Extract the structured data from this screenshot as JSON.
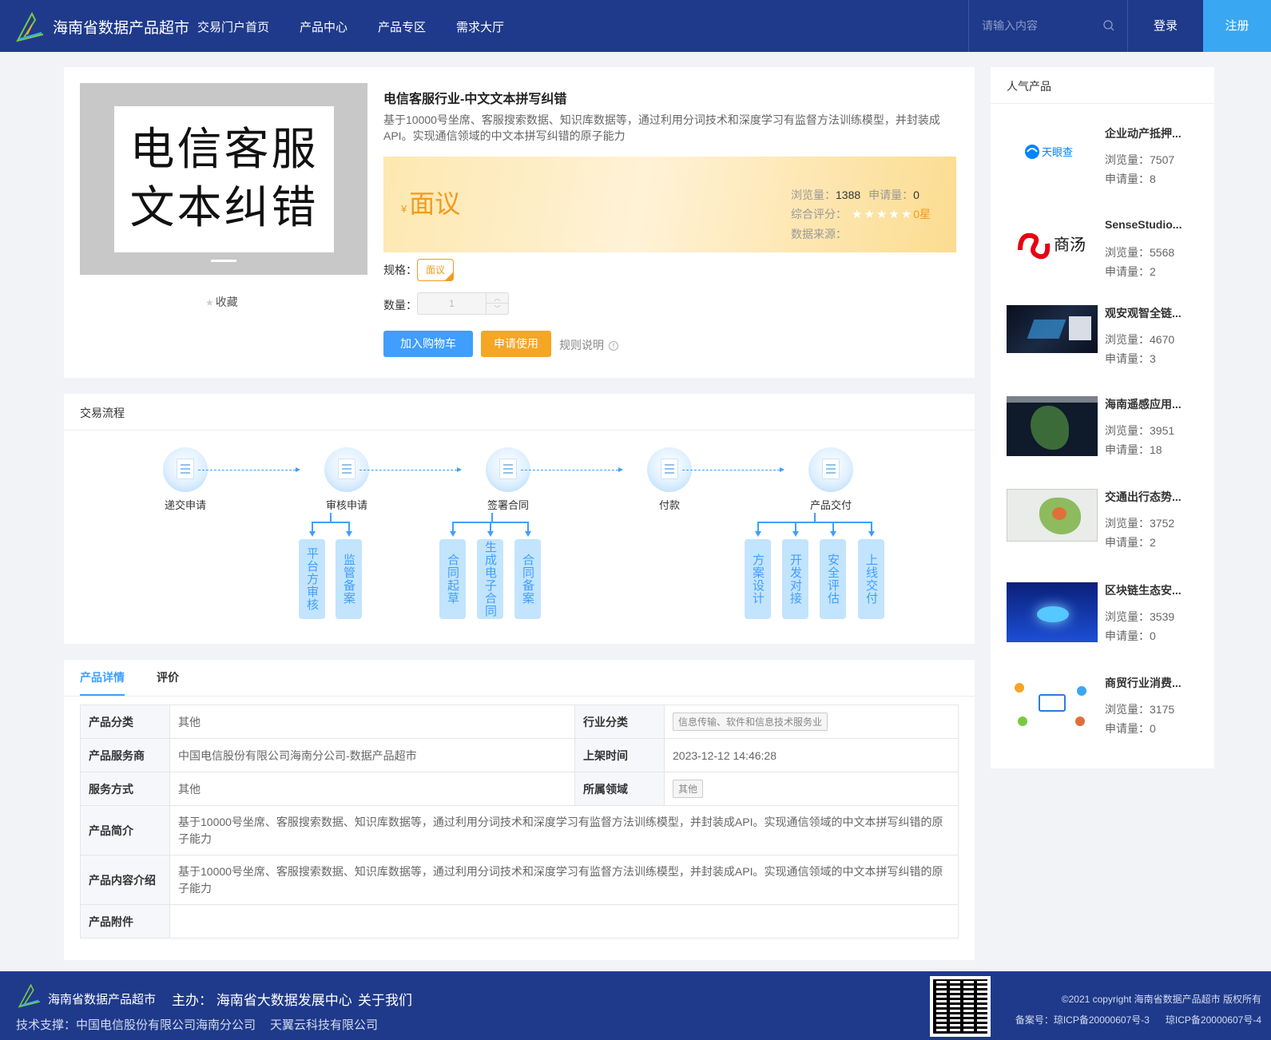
{
  "header": {
    "brand": "海南省数据产品超市",
    "nav": [
      "交易门户首页",
      "产品中心",
      "产品专区",
      "需求大厅"
    ],
    "search_placeholder": "请输入内容",
    "login": "登录",
    "register": "注册"
  },
  "product": {
    "image_text_line1": "电信客服",
    "image_text_line2": "文本纠错",
    "favorite": "收藏",
    "title": "电信客服行业-中文文本拼写纠错",
    "description": "基于10000号坐席、客服搜索数据、知识库数据等，通过利用分词技术和深度学习有监督方法训练模型，并封装成API。实现通信领域的中文本拼写纠错的原子能力",
    "currency": "¥",
    "price": "面议",
    "views_label": "浏览量：",
    "views": "1388",
    "applies_label": "申请量：",
    "applies": "0",
    "rating_label": "综合评分：",
    "rating_text": "0星",
    "rating_stars": 0,
    "source_label": "数据来源：",
    "spec_label": "规格：",
    "spec_value": "面议",
    "qty_label": "数量：",
    "qty_value": "1",
    "btn_cart": "加入购物车",
    "btn_apply": "申请使用",
    "rules": "规则说明"
  },
  "flow": {
    "title": "交易流程",
    "steps": [
      "递交申请",
      "审核申请",
      "签署合同",
      "付款",
      "产品交付"
    ],
    "audit_children": [
      "平台方审核",
      "监管备案"
    ],
    "contract_children": [
      "合同起草",
      "生成电子合同",
      "合同备案"
    ],
    "delivery_children": [
      "方案设计",
      "开发对接",
      "安全评估",
      "上线交付"
    ]
  },
  "detail": {
    "tabs": [
      "产品详情",
      "评价"
    ],
    "rows": {
      "category_k": "产品分类",
      "category_v": "其他",
      "industry_k": "行业分类",
      "industry_v": "信息传输、软件和信息技术服务业",
      "provider_k": "产品服务商",
      "provider_v": "中国电信股份有限公司海南分公司-数据产品超市",
      "online_k": "上架时间",
      "online_v": "2023-12-12 14:46:28",
      "service_k": "服务方式",
      "service_v": "其他",
      "domain_k": "所属领域",
      "domain_v": "其他",
      "intro_k": "产品简介",
      "intro_v": "基于10000号坐席、客服搜索数据、知识库数据等，通过利用分词技术和深度学习有监督方法训练模型，并封装成API。实现通信领域的中文本拼写纠错的原子能力",
      "content_k": "产品内容介绍",
      "content_v": "基于10000号坐席、客服搜索数据、知识库数据等，通过利用分词技术和深度学习有监督方法训练模型，并封装成API。实现通信领域的中文本拼写纠错的原子能力",
      "attach_k": "产品附件",
      "attach_v": ""
    }
  },
  "popular": {
    "title": "人气产品",
    "items": [
      {
        "name": "企业动产抵押...",
        "views": "浏览量：7507",
        "applies": "申请量：8",
        "logo_text": "天眼查"
      },
      {
        "name": "SenseStudio...",
        "views": "浏览量：5568",
        "applies": "申请量：2",
        "logo_text": "商汤"
      },
      {
        "name": "观安观智全链...",
        "views": "浏览量：4670",
        "applies": "申请量：3"
      },
      {
        "name": "海南遥感应用...",
        "views": "浏览量：3951",
        "applies": "申请量：18"
      },
      {
        "name": "交通出行态势...",
        "views": "浏览量：3752",
        "applies": "申请量：2"
      },
      {
        "name": "区块链生态安...",
        "views": "浏览量：3539",
        "applies": "申请量：0"
      },
      {
        "name": "商贸行业消费...",
        "views": "浏览量：3175",
        "applies": "申请量：0"
      }
    ]
  },
  "footer": {
    "brand": "海南省数据产品超市",
    "host": "主办： 海南省大数据发展中心",
    "about": "关于我们",
    "tech_label": "技术支撑：中国电信股份有限公司海南分公司",
    "tech_partner": "天翼云科技有限公司",
    "copyright": "©2021 copyright 海南省数据产品超市 版权所有",
    "icp1": "备案号：琼ICP备20000607号-3",
    "icp2": "琼ICP备20000607号-4"
  },
  "colors": {
    "header": "#1f3a8a",
    "accent": "#409eff",
    "price": "#f29b1f",
    "register": "#3aa7f2"
  }
}
